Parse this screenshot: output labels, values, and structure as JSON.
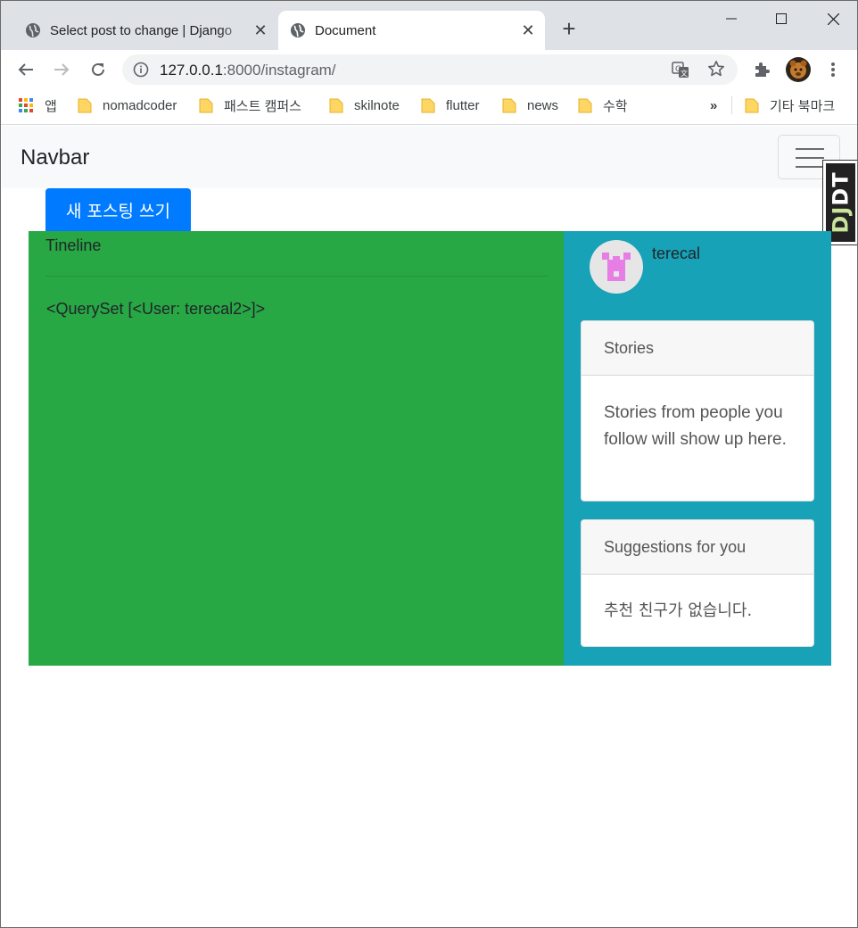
{
  "browser": {
    "tabs": [
      {
        "title": "Select post to change | Django",
        "active": false
      },
      {
        "title": "Document",
        "active": true
      }
    ],
    "url": {
      "host": "127.0.0.1",
      "rest": ":8000/instagram/"
    },
    "bookmarks": {
      "apps_label": "앱",
      "items": [
        "nomadcoder",
        "패스트 캠퍼스",
        "skilnote",
        "flutter",
        "news",
        "수학"
      ],
      "overflow": "»",
      "other": "기타 북마크"
    }
  },
  "page": {
    "navbar_brand": "Navbar",
    "new_post_button": "새 포스팅 쓰기",
    "timeline_heading": "Tineline",
    "queryset_text": "<QuerySet [<User: terecal2>]>",
    "username": "terecal",
    "stories": {
      "header": "Stories",
      "body": "Stories from people you follow will show up here."
    },
    "suggestions": {
      "header": "Suggestions for you",
      "body": "추천 친구가 없습니다."
    },
    "debug_toolbar_label": "DJDT"
  },
  "colors": {
    "primary": "#007bff",
    "timeline_bg": "#28a745",
    "sidebar_bg": "#17a2b8",
    "navbar_bg": "#f8f9fa",
    "avatar_identicon": "#e67ee6"
  }
}
